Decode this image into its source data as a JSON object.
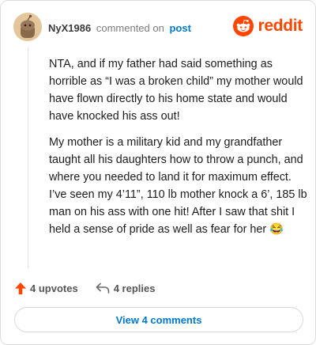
{
  "header": {
    "username": "NyX1986",
    "commented_on": "commented on",
    "post_link": "post",
    "brand": "reddit"
  },
  "comment": {
    "paragraphs": [
      "NTA, and if my father had said something as horrible as “I was a broken child” my mother would have flown directly to his home state and would have knocked his ass out!",
      "My mother is a military kid and my grandfather taught all his daughters how to throw a punch, and where you needed to land it for maximum effect. I’ve seen my 4’11”, 110 lb mother knock a 6’, 185 lb man on his ass with one hit! After I saw that shit I held a sense of pride as well as fear for her 😂"
    ]
  },
  "actions": {
    "upvotes": "4 upvotes",
    "replies": "4 replies"
  },
  "footer": {
    "view_comments": "View 4 comments"
  },
  "colors": {
    "brand_orange": "#ff4500",
    "link_blue": "#0079d3",
    "upvote": "#ff4500"
  },
  "icons": {
    "avatar": "snoo-avatar",
    "brand": "reddit-snoo-icon",
    "upvote": "upvote-arrow-icon",
    "reply": "reply-arrow-icon"
  }
}
